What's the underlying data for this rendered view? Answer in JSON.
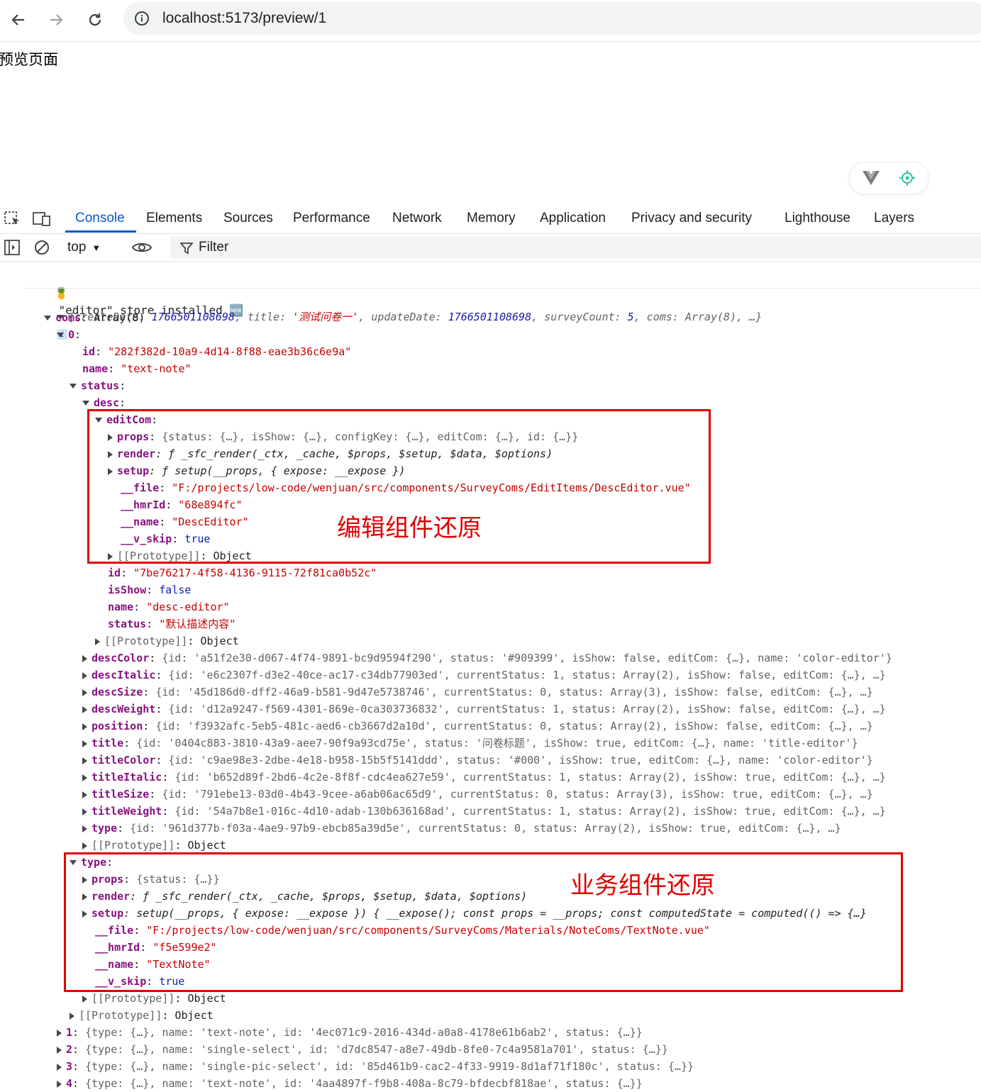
{
  "browser": {
    "url": "localhost:5173/preview/1"
  },
  "page": {
    "heading": "预览页面"
  },
  "devtools": {
    "tabs": [
      "Console",
      "Elements",
      "Sources",
      "Performance",
      "Network",
      "Memory",
      "Application",
      "Privacy and security",
      "Lighthouse",
      "Layers"
    ],
    "context": "top",
    "filter_label": "Filter"
  },
  "console": {
    "store_msg": "\"editor\" store installed 🆕",
    "lines": {
      "summary_a": "{createDate: ",
      "createDate": "1766501108698",
      "summary_b": ", title: ",
      "title": "'测试问卷一'",
      "summary_c": ", updateDate: ",
      "updateDate": "1766501108698",
      "summary_d": ", surveyCount: ",
      "surveyCount": "5",
      "summary_e": ", coms: Array(8), …}",
      "coms": "Array(8)",
      "c0_id": "\"282f382d-10a9-4d14-8f88-eae3b36c6e9a\"",
      "c0_name": "\"text-note\"",
      "props_summary": "{status: {…}, isShow: {…}, configKey: {…}, editCom: {…}, id: {…}}",
      "render_sig": "ƒ _sfc_render(_ctx, _cache, $props, $setup, $data, $options)",
      "setup_sig": "ƒ setup(__props, { expose: __expose })",
      "desc_file": "\"F:/projects/low-code/wenjuan/src/components/SurveyComs/EditItems/DescEditor.vue\"",
      "desc_hmr": "\"68e894fc\"",
      "desc_name": "\"DescEditor\"",
      "true_val": "true",
      "false_val": "false",
      "proto": "[[Prototype]]",
      "object": "Object",
      "desc_id": "\"7be76217-4f58-4136-9115-72f81ca0b52c\"",
      "desc_ename": "\"desc-editor\"",
      "desc_status": "\"默认描述内容\"",
      "type_props": "{status: {…}}",
      "type_setup": "setup(__props, { expose: __expose }) { __expose(); const props = __props; const computedState = computed(() => {…}",
      "type_file": "\"F:/projects/low-code/wenjuan/src/components/SurveyComs/Materials/NoteComs/TextNote.vue\"",
      "type_hmr": "\"f5e599e2\"",
      "type_name": "\"TextNote\""
    },
    "status_rows": [
      {
        "key": "descColor",
        "text": "{id: 'a51f2e30-d067-4f74-9891-bc9d9594f290', status: '#909399', isShow: false, editCom: {…}, name: 'color-editor'}"
      },
      {
        "key": "descItalic",
        "text": "{id: 'e6c2307f-d3e2-40ce-ac17-c34db77903ed', currentStatus: 1, status: Array(2), isShow: false, editCom: {…}, …}"
      },
      {
        "key": "descSize",
        "text": "{id: '45d186d0-dff2-46a9-b581-9d47e5738746', currentStatus: 0, status: Array(3), isShow: false, editCom: {…}, …}"
      },
      {
        "key": "descWeight",
        "text": "{id: 'd12a9247-f569-4301-869e-0ca303736832', currentStatus: 1, status: Array(2), isShow: false, editCom: {…}, …}"
      },
      {
        "key": "position",
        "text": "{id: 'f3932afc-5eb5-481c-aed6-cb3667d2a10d', currentStatus: 0, status: Array(2), isShow: false, editCom: {…}, …}"
      },
      {
        "key": "title",
        "text": "{id: '0404c883-3810-43a9-aee7-90f9a93cd75e', status: '问卷标题', isShow: true, editCom: {…}, name: 'title-editor'}"
      },
      {
        "key": "titleColor",
        "text": "{id: 'c9ae98e3-2dbe-4e18-b958-15b5f5141ddd', status: '#000', isShow: true, editCom: {…}, name: 'color-editor'}"
      },
      {
        "key": "titleItalic",
        "text": "{id: 'b652d89f-2bd6-4c2e-8f8f-cdc4ea627e59', currentStatus: 1, status: Array(2), isShow: true, editCom: {…}, …}"
      },
      {
        "key": "titleSize",
        "text": "{id: '791ebe13-03d0-4b43-9cee-a6ab06ac65d9', currentStatus: 0, status: Array(3), isShow: true, editCom: {…}, …}"
      },
      {
        "key": "titleWeight",
        "text": "{id: '54a7b8e1-016c-4d10-adab-130b636168ad', currentStatus: 1, status: Array(2), isShow: true, editCom: {…}, …}"
      },
      {
        "key": "type",
        "text": "{id: '961d377b-f03a-4ae9-97b9-ebcb85a39d5e', currentStatus: 0, status: Array(2), isShow: true, editCom: {…}, …}"
      }
    ],
    "coms_rows": [
      {
        "key": "1",
        "text": "{type: {…}, name: 'text-note', id: '4ec071c9-2016-434d-a0a8-4178e61b6ab2', status: {…}}"
      },
      {
        "key": "2",
        "text": "{type: {…}, name: 'single-select', id: 'd7dc8547-a8e7-49db-8fe0-7c4a9581a701', status: {…}}"
      },
      {
        "key": "3",
        "text": "{type: {…}, name: 'single-pic-select', id: '85d461b9-cac2-4f33-9919-8d1af71f180c', status: {…}}"
      },
      {
        "key": "4",
        "text": "{type: {…}, name: 'text-note', id: '4aa4897f-f9b8-408a-8c79-bfdecbf818ae', status: {…}}"
      }
    ]
  },
  "annotations": {
    "box1": "编辑组件还原",
    "box2": "业务组件还原"
  },
  "colors": {
    "accent": "#0b57d0",
    "annotation_red": "#e00000",
    "string": "#c80000",
    "key": "#881280"
  }
}
